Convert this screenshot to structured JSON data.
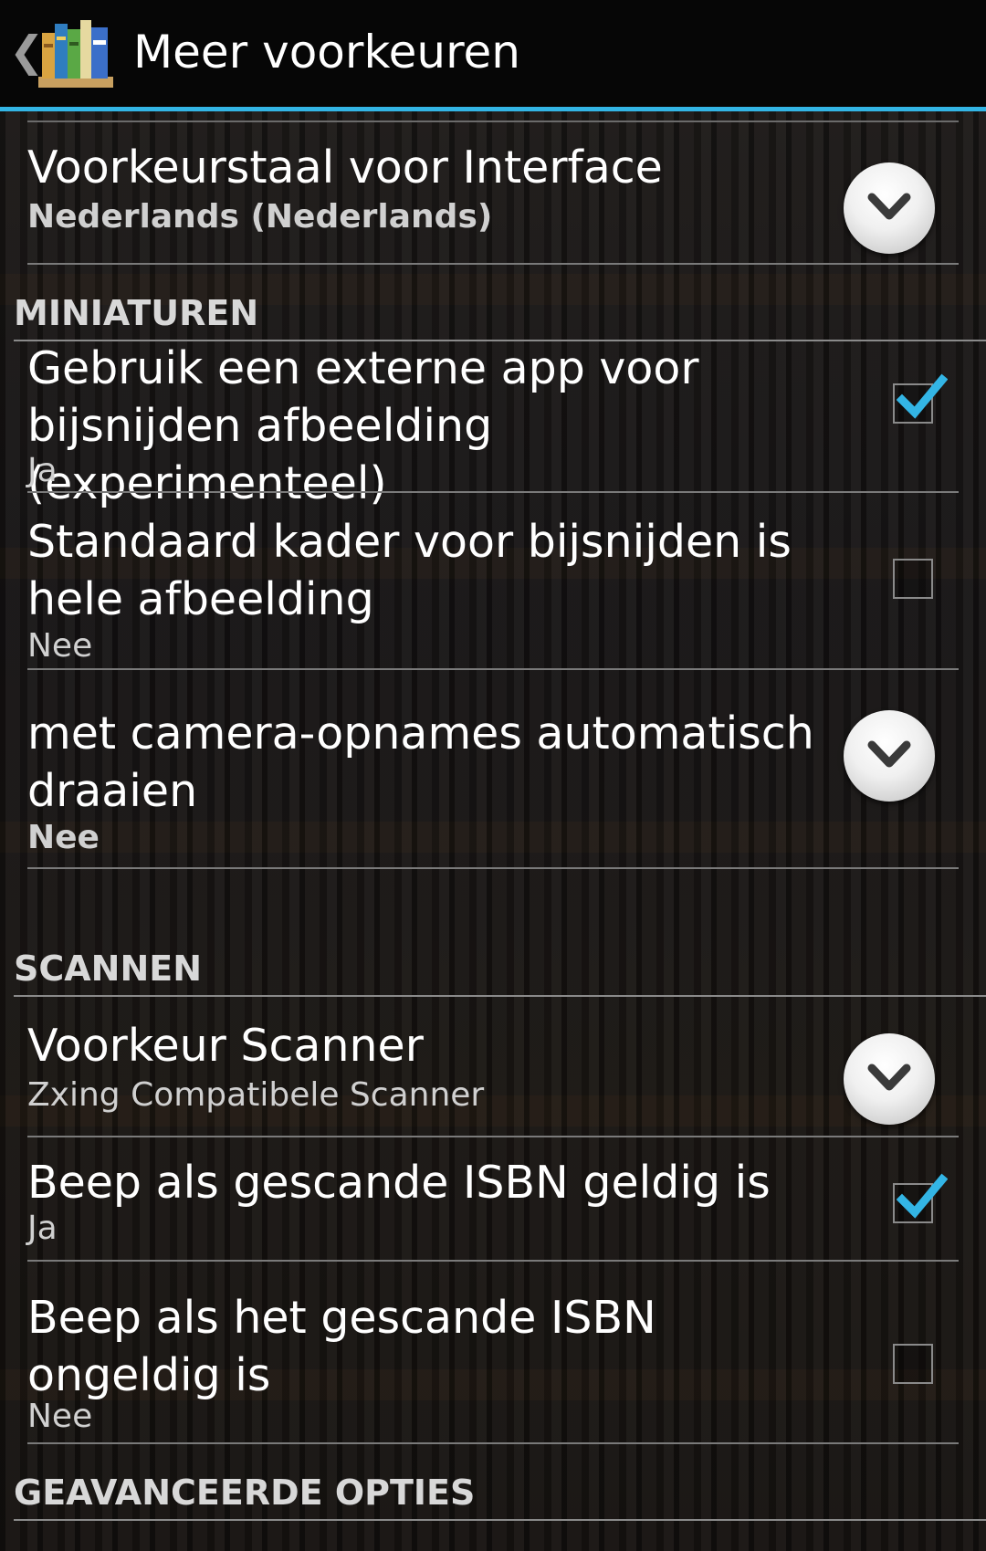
{
  "action_bar": {
    "title": "Meer voorkeuren",
    "accent_color": "#33b5e5"
  },
  "items": [
    {
      "title": "Voorkeurstaal voor Interface",
      "summary": "Nederlands (Nederlands)",
      "widget": "dropdown"
    },
    {
      "section": "MINIATUREN"
    },
    {
      "title": "Gebruik een externe app voor bijsnijden afbeelding (experimenteel)",
      "summary": "Ja",
      "widget": "checkbox",
      "checked": true
    },
    {
      "title": "Standaard kader voor bijsnijden is hele afbeelding",
      "summary": "Nee",
      "widget": "checkbox",
      "checked": false
    },
    {
      "title": "met camera-opnames automatisch draaien",
      "summary": "Nee",
      "widget": "dropdown"
    },
    {
      "section": "SCANNEN"
    },
    {
      "title": "Voorkeur Scanner",
      "summary": "Zxing Compatibele Scanner",
      "widget": "dropdown"
    },
    {
      "title": "Beep als gescande ISBN geldig is",
      "summary": "Ja",
      "widget": "checkbox",
      "checked": true
    },
    {
      "title": "Beep als het gescande ISBN ongeldig is",
      "summary": "Nee",
      "widget": "checkbox",
      "checked": false
    },
    {
      "section": "GEAVANCEERDE OPTIES"
    }
  ]
}
